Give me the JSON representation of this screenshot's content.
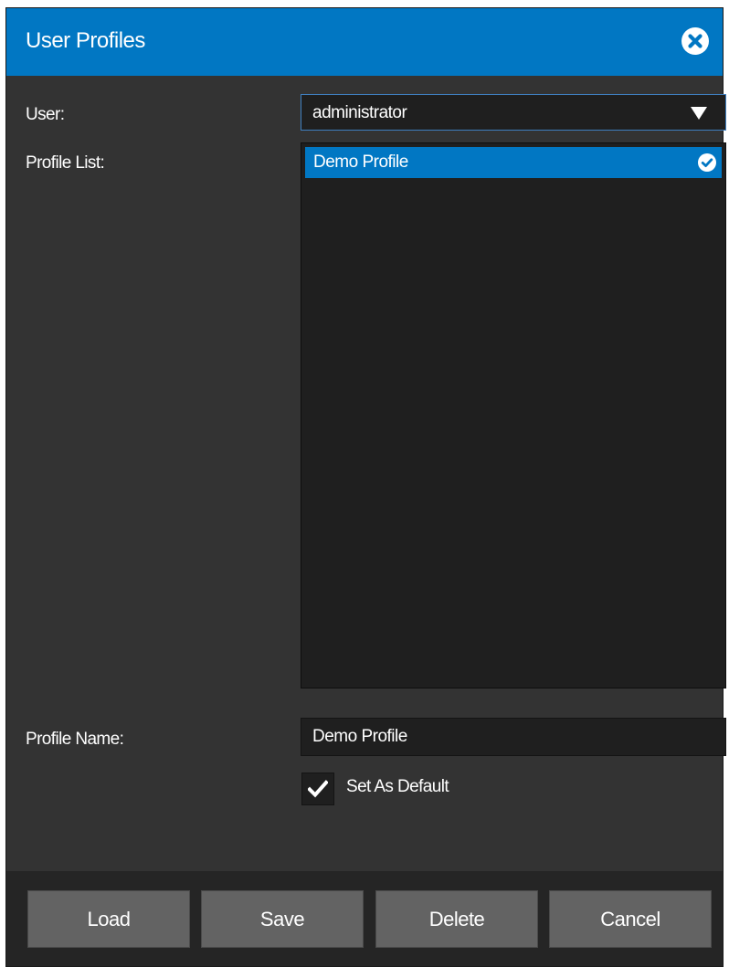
{
  "dialog": {
    "title": "User Profiles"
  },
  "form": {
    "user_label": "User:",
    "user_value": "administrator",
    "profile_list_label": "Profile List:",
    "profiles": [
      "Demo Profile"
    ],
    "profile_name_label": "Profile Name:",
    "profile_name_value": "Demo Profile",
    "set_default_label": "Set As Default",
    "set_default_checked": true
  },
  "buttons": {
    "load": "Load",
    "save": "Save",
    "delete": "Delete",
    "cancel": "Cancel"
  },
  "icons": {
    "close": "close-circle-icon",
    "dropdown": "caret-down-icon",
    "selected": "check-circle-icon",
    "checkbox": "checkmark-icon"
  },
  "colors": {
    "accent": "#0177c3",
    "panel": "#333333",
    "field": "#1f1f1f",
    "footer": "#252525",
    "button": "#636363"
  }
}
